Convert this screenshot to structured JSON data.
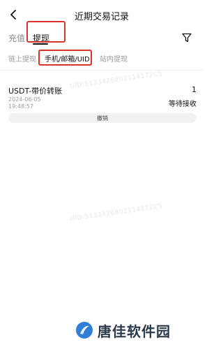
{
  "header": {
    "title": "近期交易记录",
    "back_icon": "chevron-left-icon"
  },
  "tabs": [
    {
      "label": "充值",
      "active": false
    },
    {
      "label": "提现",
      "active": true
    }
  ],
  "filter_icon": "funnel-icon",
  "subtabs": [
    {
      "label": "链上提现",
      "active": false
    },
    {
      "label": "手机/邮箱/UID",
      "active": true
    },
    {
      "label": "站内提现",
      "active": false
    }
  ],
  "record": {
    "title": "USDT-带价转账",
    "amount": "1",
    "date": "2024-06-05",
    "time": "19:48:57",
    "status": "等待接收",
    "cancel_label": "撤销"
  },
  "watermark": "UID:5133426802114172C5",
  "brand": {
    "name": "唐佳软件园"
  },
  "colors": {
    "highlight": "#d9342b",
    "accent": "#111111",
    "muted": "#9a9a9a"
  }
}
